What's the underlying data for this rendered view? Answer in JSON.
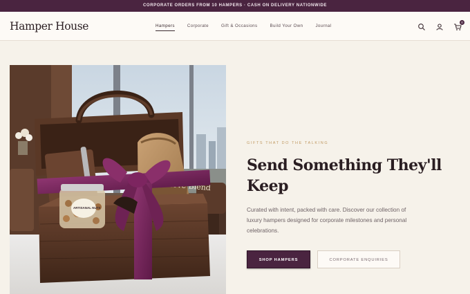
{
  "announcement": "CORPORATE ORDERS FROM 10 HAMPERS · CASH ON DELIVERY NATIONWIDE",
  "header": {
    "logo": "Hamper House",
    "nav": [
      "Hampers",
      "Corporate",
      "Gift & Occasions",
      "Build Your Own",
      "Journal"
    ],
    "active_nav": "Hampers",
    "icons": [
      "search-icon",
      "account-icon",
      "cart-icon"
    ],
    "cart_count": "0"
  },
  "hero": {
    "eyebrow": "GIFTS THAT DO THE TALKING",
    "headline": "Send Something They'll Keep",
    "description": "Curated with intent, packed with care. Discover our collection of luxury hampers designed for corporate milestones and personal celebrations.",
    "primary_button": "SHOP HAMPERS",
    "secondary_button": "CORPORATE ENQUIRIES",
    "image": {
      "jar_label": "ARTISANAL NUTS",
      "bag_label": "Reserve Blend"
    }
  },
  "colors": {
    "brand": "#4a2440",
    "accent": "#c19a63",
    "background": "#f6f2ea",
    "ribbon": "#7d2560"
  }
}
